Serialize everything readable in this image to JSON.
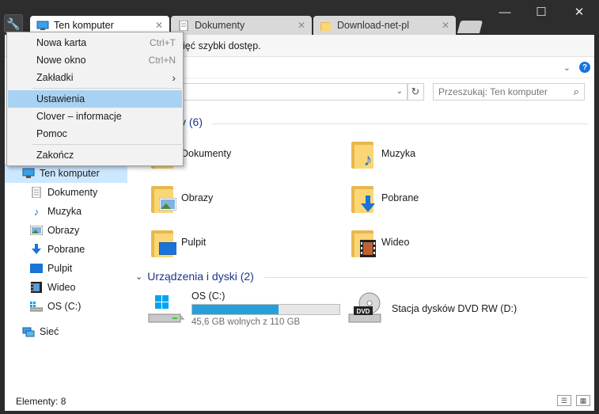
{
  "tabs": [
    {
      "label": "Ten komputer",
      "close": "✕"
    },
    {
      "label": "Dokumenty",
      "close": "✕"
    },
    {
      "label": "Download-net-pl",
      "close": "✕"
    }
  ],
  "window_controls": {
    "minimize": "—",
    "maximize": "☐",
    "close": "✕"
  },
  "infobar": {
    "text": "ięć szybki dostęp."
  },
  "address": {
    "chevron": "⌄",
    "refresh": "↻"
  },
  "search": {
    "placeholder": "Przeszukaj: Ten komputer",
    "icon": "⌕"
  },
  "help": "?",
  "sidebar": {
    "items": [
      {
        "label": "Ten komputer",
        "icon": "monitor-icon"
      },
      {
        "label": "Dokumenty",
        "icon": "document-icon"
      },
      {
        "label": "Muzyka",
        "icon": "music-icon"
      },
      {
        "label": "Obrazy",
        "icon": "pictures-icon"
      },
      {
        "label": "Pobrane",
        "icon": "download-icon"
      },
      {
        "label": "Pulpit",
        "icon": "desktop-icon"
      },
      {
        "label": "Wideo",
        "icon": "video-icon"
      },
      {
        "label": "OS (C:)",
        "icon": "drive-icon"
      },
      {
        "label": "Sieć",
        "icon": "network-icon"
      }
    ]
  },
  "content": {
    "folders_header": "y (6)",
    "folders": [
      {
        "label": "Dokumenty",
        "icon": "documents-folder-icon"
      },
      {
        "label": "Muzyka",
        "icon": "music-folder-icon"
      },
      {
        "label": "Obrazy",
        "icon": "pictures-folder-icon"
      },
      {
        "label": "Pobrane",
        "icon": "downloads-folder-icon"
      },
      {
        "label": "Pulpit",
        "icon": "desktop-folder-icon"
      },
      {
        "label": "Wideo",
        "icon": "video-folder-icon"
      }
    ],
    "devices_header": "Urządzenia i dyski (2)",
    "drives": [
      {
        "label": "OS (C:)",
        "free": "45,6 GB wolnych z 110 GB",
        "used_fraction": 0.585
      },
      {
        "label": "Stacja dysków DVD RW (D:)",
        "badge": "DVD"
      }
    ]
  },
  "status": {
    "count": "Elementy: 8"
  },
  "menu": {
    "items": [
      {
        "label": "Nowa karta",
        "shortcut": "Ctrl+T"
      },
      {
        "label": "Nowe okno",
        "shortcut": "Ctrl+N"
      },
      {
        "label": "Zakładki",
        "shortcut": "›"
      },
      {
        "label": "Ustawienia",
        "shortcut": ""
      },
      {
        "label": "Clover – informacje",
        "shortcut": ""
      },
      {
        "label": "Pomoc",
        "shortcut": ""
      },
      {
        "label": "Zakończ",
        "shortcut": ""
      }
    ]
  },
  "colors": {
    "accent": "#26a0da",
    "header": "#1e3287",
    "menu_highlight": "#a8d2f3"
  }
}
